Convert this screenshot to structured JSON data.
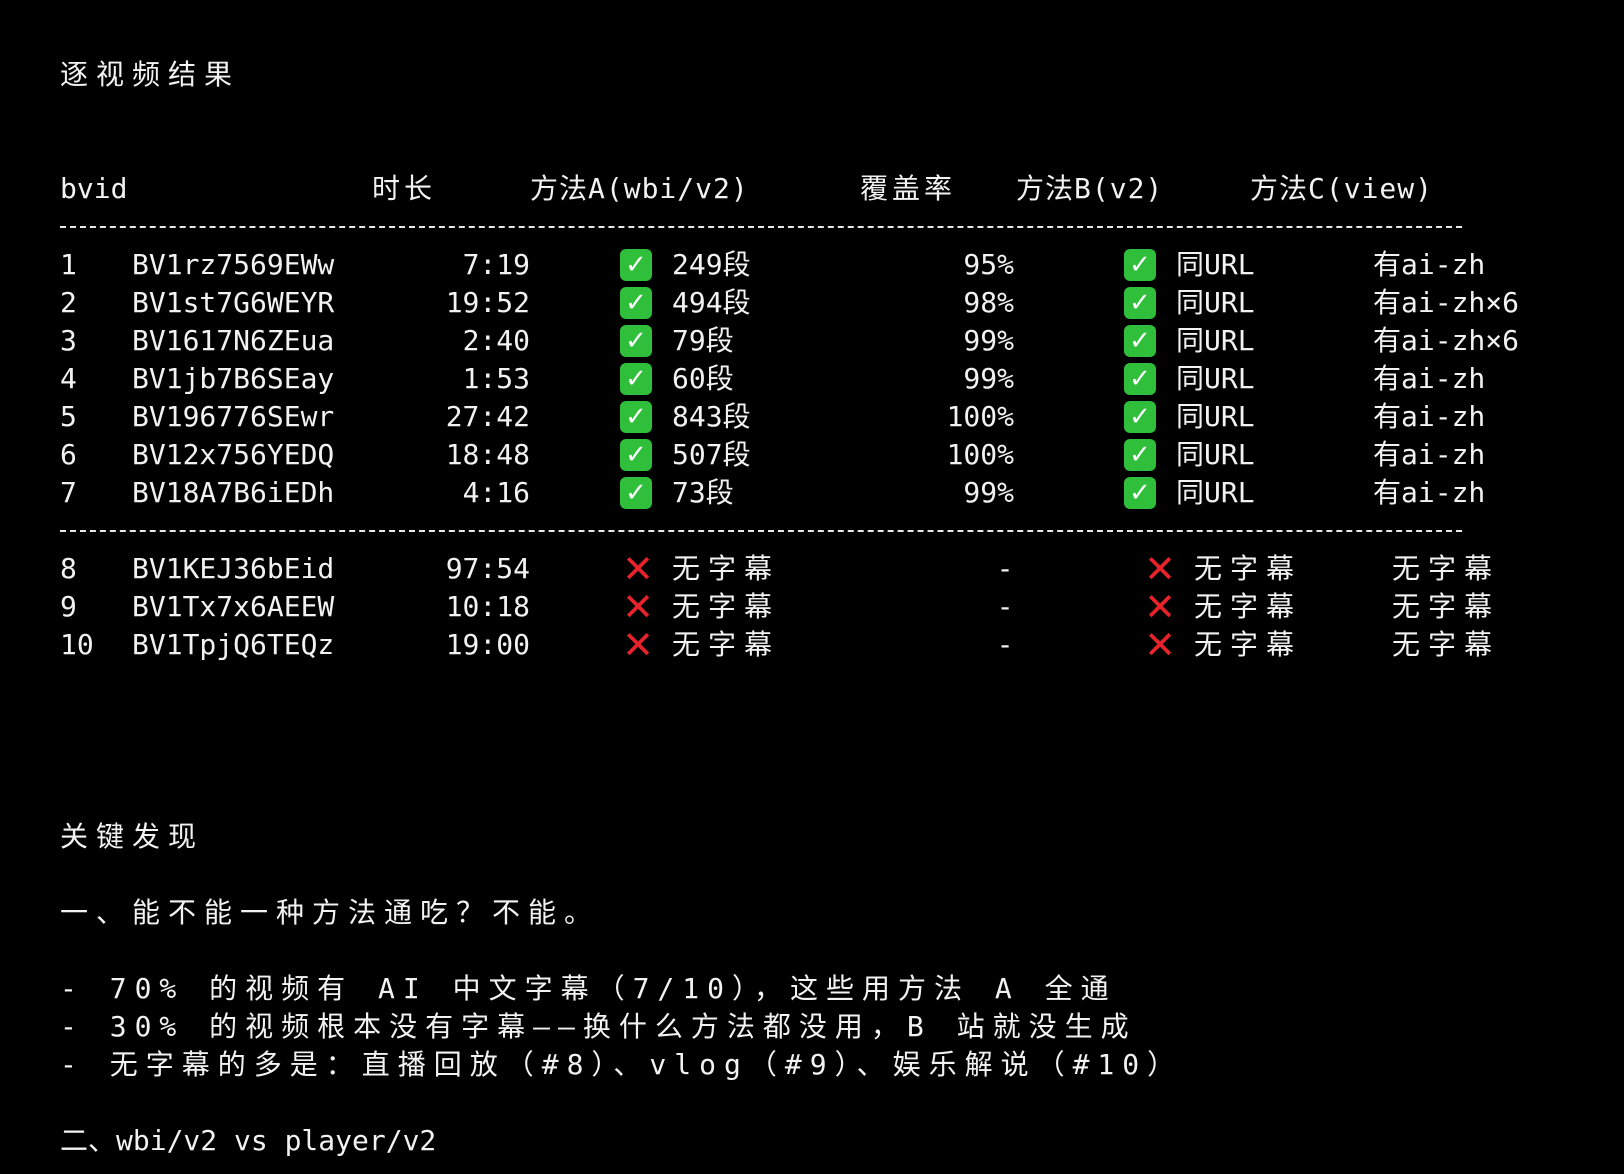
{
  "colors": {
    "background": "#000000",
    "text": "#f2f2f2",
    "check_bg": "#2fbf3a",
    "cross": "#e8222a"
  },
  "icons": {
    "check": "✓",
    "cross": "✕"
  },
  "section_title": "逐视频结果",
  "table": {
    "headers": {
      "bvid": "bvid",
      "duration": "时长",
      "method_a": "方法A(wbi/v2)",
      "coverage": "覆盖率",
      "method_b": "方法B(v2)",
      "method_c": "方法C(view)"
    },
    "rows": [
      {
        "num": "1",
        "bvid": "BV1rz7569EWw",
        "duration": "7:19",
        "method_a": "249段",
        "coverage": "95%",
        "method_b": "同URL",
        "method_c": "有ai-zh"
      },
      {
        "num": "2",
        "bvid": "BV1st7G6WEYR",
        "duration": "19:52",
        "method_a": "494段",
        "coverage": "98%",
        "method_b": "同URL",
        "method_c": "有ai-zh×6"
      },
      {
        "num": "3",
        "bvid": "BV1617N6ZEua",
        "duration": "2:40",
        "method_a": "79段",
        "coverage": "99%",
        "method_b": "同URL",
        "method_c": "有ai-zh×6"
      },
      {
        "num": "4",
        "bvid": "BV1jb7B6SEay",
        "duration": "1:53",
        "method_a": "60段",
        "coverage": "99%",
        "method_b": "同URL",
        "method_c": "有ai-zh"
      },
      {
        "num": "5",
        "bvid": "BV196776SEwr",
        "duration": "27:42",
        "method_a": "843段",
        "coverage": "100%",
        "method_b": "同URL",
        "method_c": "有ai-zh"
      },
      {
        "num": "6",
        "bvid": "BV12x756YEDQ",
        "duration": "18:48",
        "method_a": "507段",
        "coverage": "100%",
        "method_b": "同URL",
        "method_c": "有ai-zh"
      },
      {
        "num": "7",
        "bvid": "BV18A7B6iEDh",
        "duration": "4:16",
        "method_a": "73段",
        "coverage": "99%",
        "method_b": "同URL",
        "method_c": "有ai-zh"
      }
    ],
    "failed_rows": [
      {
        "num": "8",
        "bvid": "BV1KEJ36bEid",
        "duration": "97:54",
        "method_a": "无字幕",
        "coverage": "-",
        "method_b": "无字幕",
        "method_c": "无字幕"
      },
      {
        "num": "9",
        "bvid": "BV1Tx7x6AEEW",
        "duration": "10:18",
        "method_a": "无字幕",
        "coverage": "-",
        "method_b": "无字幕",
        "method_c": "无字幕"
      },
      {
        "num": "10",
        "bvid": "BV1TpjQ6TEQz",
        "duration": "19:00",
        "method_a": "无字幕",
        "coverage": "-",
        "method_b": "无字幕",
        "method_c": "无字幕"
      }
    ]
  },
  "findings": {
    "title": "关键发现",
    "q1": "一、能不能一种方法通吃？不能。",
    "bullets": [
      "- 70% 的视频有 AI 中文字幕（7/10），这些用方法 A 全通",
      "- 30% 的视频根本没有字幕——换什么方法都没用，B 站就没生成",
      "- 无字幕的多是：直播回放（#8）、vlog（#9）、娱乐解说（#10）"
    ],
    "q2": "二、wbi/v2 vs player/v2"
  }
}
